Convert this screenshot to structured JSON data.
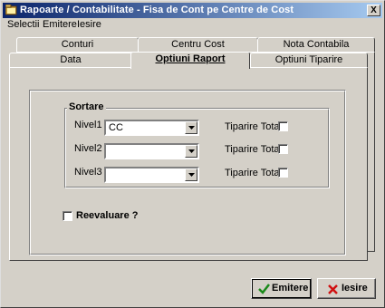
{
  "window": {
    "title": "Rapoarte / Contabilitate - Fisa de Cont pe Centre de Cost",
    "close_label": "X"
  },
  "menu": {
    "items": [
      "Selectii",
      "Emitere",
      "Iesire"
    ]
  },
  "tabs": {
    "back_row": [
      "Conturi",
      "Centru Cost",
      "Nota Contabila"
    ],
    "front_row": [
      "Data",
      "Optiuni Raport",
      "Optiuni Tiparire"
    ],
    "active": "Optiuni Raport"
  },
  "sortare": {
    "group_label": "Sortare",
    "rows": [
      {
        "label": "Nivel1",
        "value": "CC",
        "total_label": "Tiparire Total",
        "total_checked": false
      },
      {
        "label": "Nivel2",
        "value": "",
        "total_label": "Tiparire Total",
        "total_checked": false
      },
      {
        "label": "Nivel3",
        "value": "",
        "total_label": "Tiparire Total",
        "total_checked": false
      }
    ]
  },
  "reevaluare": {
    "label": "Reevaluare ?",
    "checked": false
  },
  "buttons": {
    "emitere_label": "Emitere",
    "iesire_label": "Iesire"
  },
  "colors": {
    "title_start": "#0a246a",
    "title_end": "#a6caf0",
    "face": "#d4d0c8",
    "emitere_icon": "#1a8a1a",
    "iesire_icon": "#d01010"
  }
}
